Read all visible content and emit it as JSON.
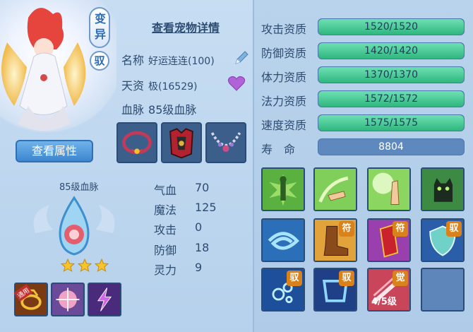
{
  "pet": {
    "variant_badge": "变异",
    "control_badge": "驭",
    "details_link": "查看宠物详情",
    "name_label": "名称",
    "name_value": "好运连连(100)",
    "talent_label": "天资",
    "talent_value": "极(16529)",
    "bloodline_label": "血脉",
    "bloodline_value": "85级血脉",
    "view_attributes_button": "查看属性"
  },
  "bloodline_panel": {
    "title": "85级血脉",
    "stars": 3
  },
  "stats": [
    {
      "label": "气血",
      "value": "70"
    },
    {
      "label": "魔法",
      "value": "125"
    },
    {
      "label": "攻击",
      "value": "0"
    },
    {
      "label": "防御",
      "value": "18"
    },
    {
      "label": "灵力",
      "value": "9"
    }
  ],
  "aptitudes": [
    {
      "label": "攻击资质",
      "value": "1520/1520",
      "fill": 1.0
    },
    {
      "label": "防御资质",
      "value": "1420/1420",
      "fill": 1.0
    },
    {
      "label": "体力资质",
      "value": "1370/1370",
      "fill": 1.0
    },
    {
      "label": "法力资质",
      "value": "1572/1572",
      "fill": 1.0
    },
    {
      "label": "速度资质",
      "value": "1575/1575",
      "fill": 1.0
    }
  ],
  "lifespan": {
    "label": "寿　命",
    "value": "8804"
  },
  "skill_tags": {
    "fu": "符",
    "yu": "驭",
    "jue": "觉"
  },
  "skill_level": "4/5级",
  "small_skill_tag": "通用",
  "colors": {
    "accent": "#3d86cf",
    "aptitude_fill": "#2fb67e",
    "bar_bg": "#5d89be"
  }
}
